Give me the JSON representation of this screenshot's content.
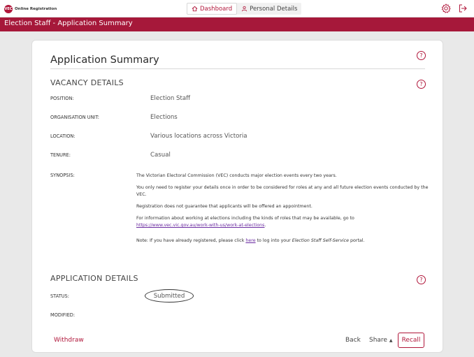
{
  "app": {
    "logo_mark": "VEC",
    "logo_text": "Online Registration"
  },
  "nav": {
    "dashboard": "Dashboard",
    "personal_details": "Personal Details"
  },
  "title_bar": "Election Staff - Application Summary",
  "card": {
    "title": "Application Summary",
    "help_glyph": "?"
  },
  "vacancy": {
    "heading": "VACANCY DETAILS",
    "position_label": "POSITION:",
    "position_value": "Election Staff",
    "unit_label": "ORGANISATION UNIT:",
    "unit_value": "Elections",
    "location_label": "LOCATION:",
    "location_value": "Various locations across Victoria",
    "tenure_label": "TENURE:",
    "tenure_value": "Casual",
    "synopsis_label": "SYNOPSIS:",
    "synopsis": {
      "p1": "The Victorian Electoral Commission (VEC) conducts major election events every two years.",
      "p2": "You only need to register your details once in order to be considered for roles at any and all future election events conducted by the VEC.",
      "p3": "Registration does not guarantee that applicants will be offered an appointment.",
      "p4_text": "For information about working at elections including the kinds of roles that may be available, go to",
      "p4_link": "https://www.vec.vic.gov.au/work-with-us/work-at-elections",
      "p4_end": ".",
      "p5_a": "Note: If you have already registered, please click ",
      "p5_link": "here",
      "p5_b": " to log into your ",
      "p5_em": "Election Staff Self-Service",
      "p5_c": " portal."
    }
  },
  "application": {
    "heading": "APPLICATION DETAILS",
    "status_label": "STATUS:",
    "status_value": "Submitted",
    "modified_label": "MODIFIED:"
  },
  "actions": {
    "withdraw": "Withdraw",
    "back": "Back",
    "share": "Share",
    "share_caret": "▲",
    "recall": "Recall"
  },
  "colors": {
    "brand": "#b0163a",
    "title_bar": "#a6183a",
    "link": "#6a2aa0"
  },
  "icons": [
    "home-icon",
    "person-icon",
    "gear-icon",
    "logout-icon",
    "help-icon"
  ]
}
